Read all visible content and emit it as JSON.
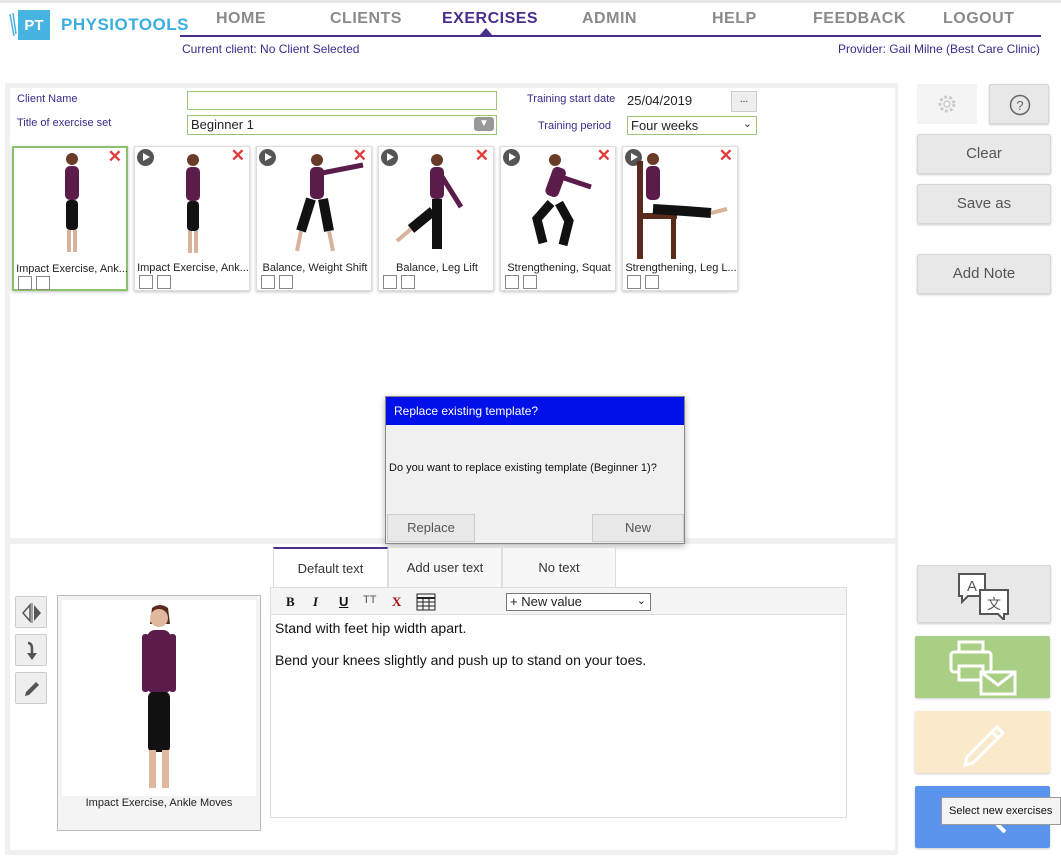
{
  "app": {
    "logo_mark": "PT",
    "logo_text": "PHYSIOTOOLS",
    "brand_color": "#3aaee0",
    "accent_color": "#4a2e8c"
  },
  "nav": {
    "home": "HOME",
    "clients": "CLIENTS",
    "exercises": "EXERCISES",
    "admin": "ADMIN",
    "help": "HELP",
    "feedback": "FEEDBACK",
    "logout": "LOGOUT",
    "active": "EXERCISES"
  },
  "header": {
    "current_client": "Current client: No Client Selected",
    "provider": "Provider: Gail Milne (Best Care Clinic)"
  },
  "form": {
    "client_name_label": "Client Name",
    "client_name_value": "",
    "title_label": "Title of exercise set",
    "title_value": "Beginner 1",
    "start_date_label": "Training start date",
    "start_date_value": "25/04/2019",
    "date_button": "...",
    "period_label": "Training period",
    "period_value": "Four weeks"
  },
  "exercises": [
    {
      "name": "Impact Exercise, Ank..."
    },
    {
      "name": "Impact Exercise, Ank..."
    },
    {
      "name": "Balance, Weight Shift"
    },
    {
      "name": "Balance, Leg Lift"
    },
    {
      "name": "Strengthening, Squat"
    },
    {
      "name": "Strengthening, Leg L..."
    }
  ],
  "dialog": {
    "title": "Replace existing template?",
    "message": "Do you want to replace existing template (Beginner 1)?",
    "replace": "Replace",
    "new": "New"
  },
  "sidebar": {
    "clear": "Clear",
    "save_as": "Save as",
    "add_note": "Add Note"
  },
  "tabs": {
    "default_text": "Default text",
    "add_user_text": "Add user text",
    "no_text": "No text"
  },
  "editor": {
    "bold": "B",
    "italic": "I",
    "underline": "U",
    "font_size": "TT",
    "clear_format": "X",
    "new_value": "+ New value",
    "line1": "Stand with feet hip width apart.",
    "line2": "Bend your knees slightly and push up to stand on your toes."
  },
  "preview": {
    "caption": "Impact Exercise, Ankle Moves"
  },
  "tooltip": "Select new exercises"
}
